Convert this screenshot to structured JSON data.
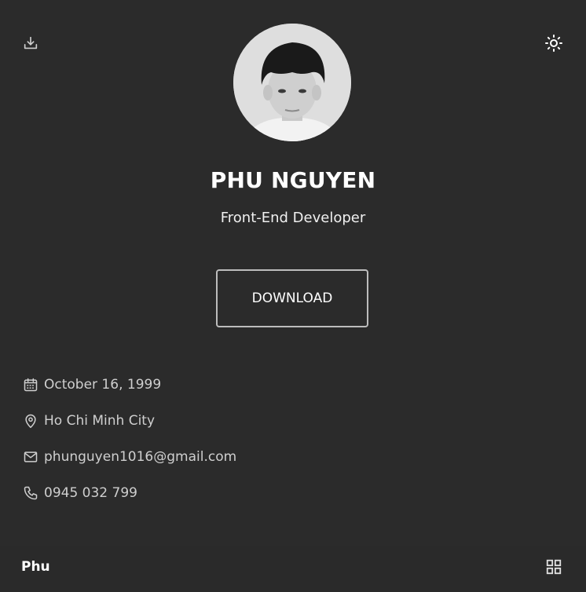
{
  "profile": {
    "name": "PHU NGUYEN",
    "role": "Front-End Developer",
    "download_label": "DOWNLOAD"
  },
  "info": {
    "birthday": "October 16, 1999",
    "location": "Ho Chi Minh City",
    "email": "phunguyen1016@gmail.com",
    "phone": "0945 032 799"
  },
  "footer": {
    "brand": "Phu"
  },
  "icons": {
    "top_left": "download-icon",
    "top_right": "sun-icon",
    "birthday": "calendar-icon",
    "location": "location-pin-icon",
    "email": "mail-icon",
    "phone": "phone-icon",
    "menu": "grid-menu-icon"
  },
  "colors": {
    "background": "#2b2b2b",
    "text": "#ffffff",
    "muted_text": "#cfcfcf",
    "button_border": "#bdbdbd"
  }
}
